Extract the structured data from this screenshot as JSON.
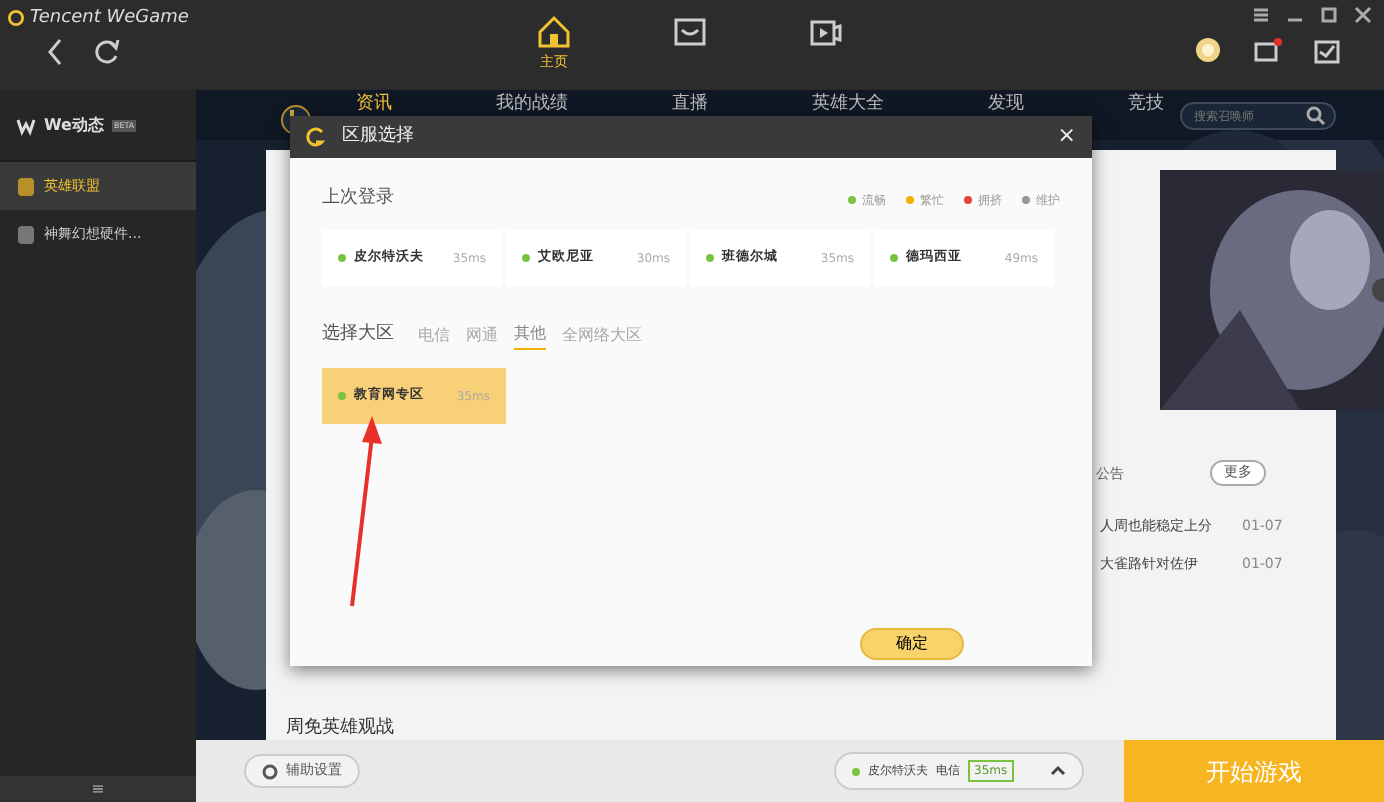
{
  "app": {
    "title": "Tencent WeGame"
  },
  "top_nav": [
    {
      "kind": "home",
      "label": "主页",
      "selected": true
    },
    {
      "kind": "store",
      "selected": false
    },
    {
      "kind": "video",
      "selected": false
    }
  ],
  "sidebar": {
    "header": {
      "label": "We动态",
      "badge": "BETA"
    },
    "items": [
      {
        "label": "英雄联盟",
        "selected": true
      },
      {
        "label": "神舞幻想硬件...",
        "selected": false
      }
    ],
    "menu_glyph": "≡"
  },
  "game_tabs": [
    {
      "label": "资讯",
      "selected": true
    },
    {
      "label": "我的战绩",
      "selected": false
    },
    {
      "label": "直播",
      "selected": false
    },
    {
      "label": "英雄大全",
      "selected": false
    },
    {
      "label": "发现",
      "selected": false
    },
    {
      "label": "竞技",
      "selected": false
    }
  ],
  "search": {
    "placeholder": "搜索召唤师"
  },
  "news": {
    "tab": "公告",
    "more": "更多",
    "rows": [
      {
        "title": "人周也能稳定上分",
        "date": "01-07"
      },
      {
        "title": "大雀路针对佐伊",
        "date": "01-07"
      }
    ]
  },
  "section_title": "周免英雄观战",
  "dialog": {
    "title": "区服选择",
    "close": "×",
    "recent_label": "上次登录",
    "legend": [
      {
        "label": "流畅",
        "color": "#7cc242"
      },
      {
        "label": "繁忙",
        "color": "#f0b400"
      },
      {
        "label": "拥挤",
        "color": "#e8453c"
      },
      {
        "label": "维护",
        "color": "#999999"
      }
    ],
    "recent": [
      {
        "name": "皮尔特沃夫",
        "ping": "35ms",
        "color": "#7cc242"
      },
      {
        "name": "艾欧尼亚",
        "ping": "30ms",
        "color": "#7cc242"
      },
      {
        "name": "班德尔城",
        "ping": "35ms",
        "color": "#7cc242"
      },
      {
        "name": "德玛西亚",
        "ping": "49ms",
        "color": "#7cc242"
      }
    ],
    "region_label": "选择大区",
    "region_tabs": [
      {
        "label": "电信",
        "selected": false
      },
      {
        "label": "网通",
        "selected": false
      },
      {
        "label": "其他",
        "selected": true
      },
      {
        "label": "全网络大区",
        "selected": false
      }
    ],
    "servers": [
      {
        "name": "教育网专区",
        "ping": "35ms",
        "color": "#7cc242",
        "selected": true
      }
    ],
    "confirm": "确定"
  },
  "bottom_bar": {
    "assist": "辅助设置",
    "server": "皮尔特沃夫",
    "network": "电信",
    "ping": "35ms",
    "start": "开始游戏"
  }
}
